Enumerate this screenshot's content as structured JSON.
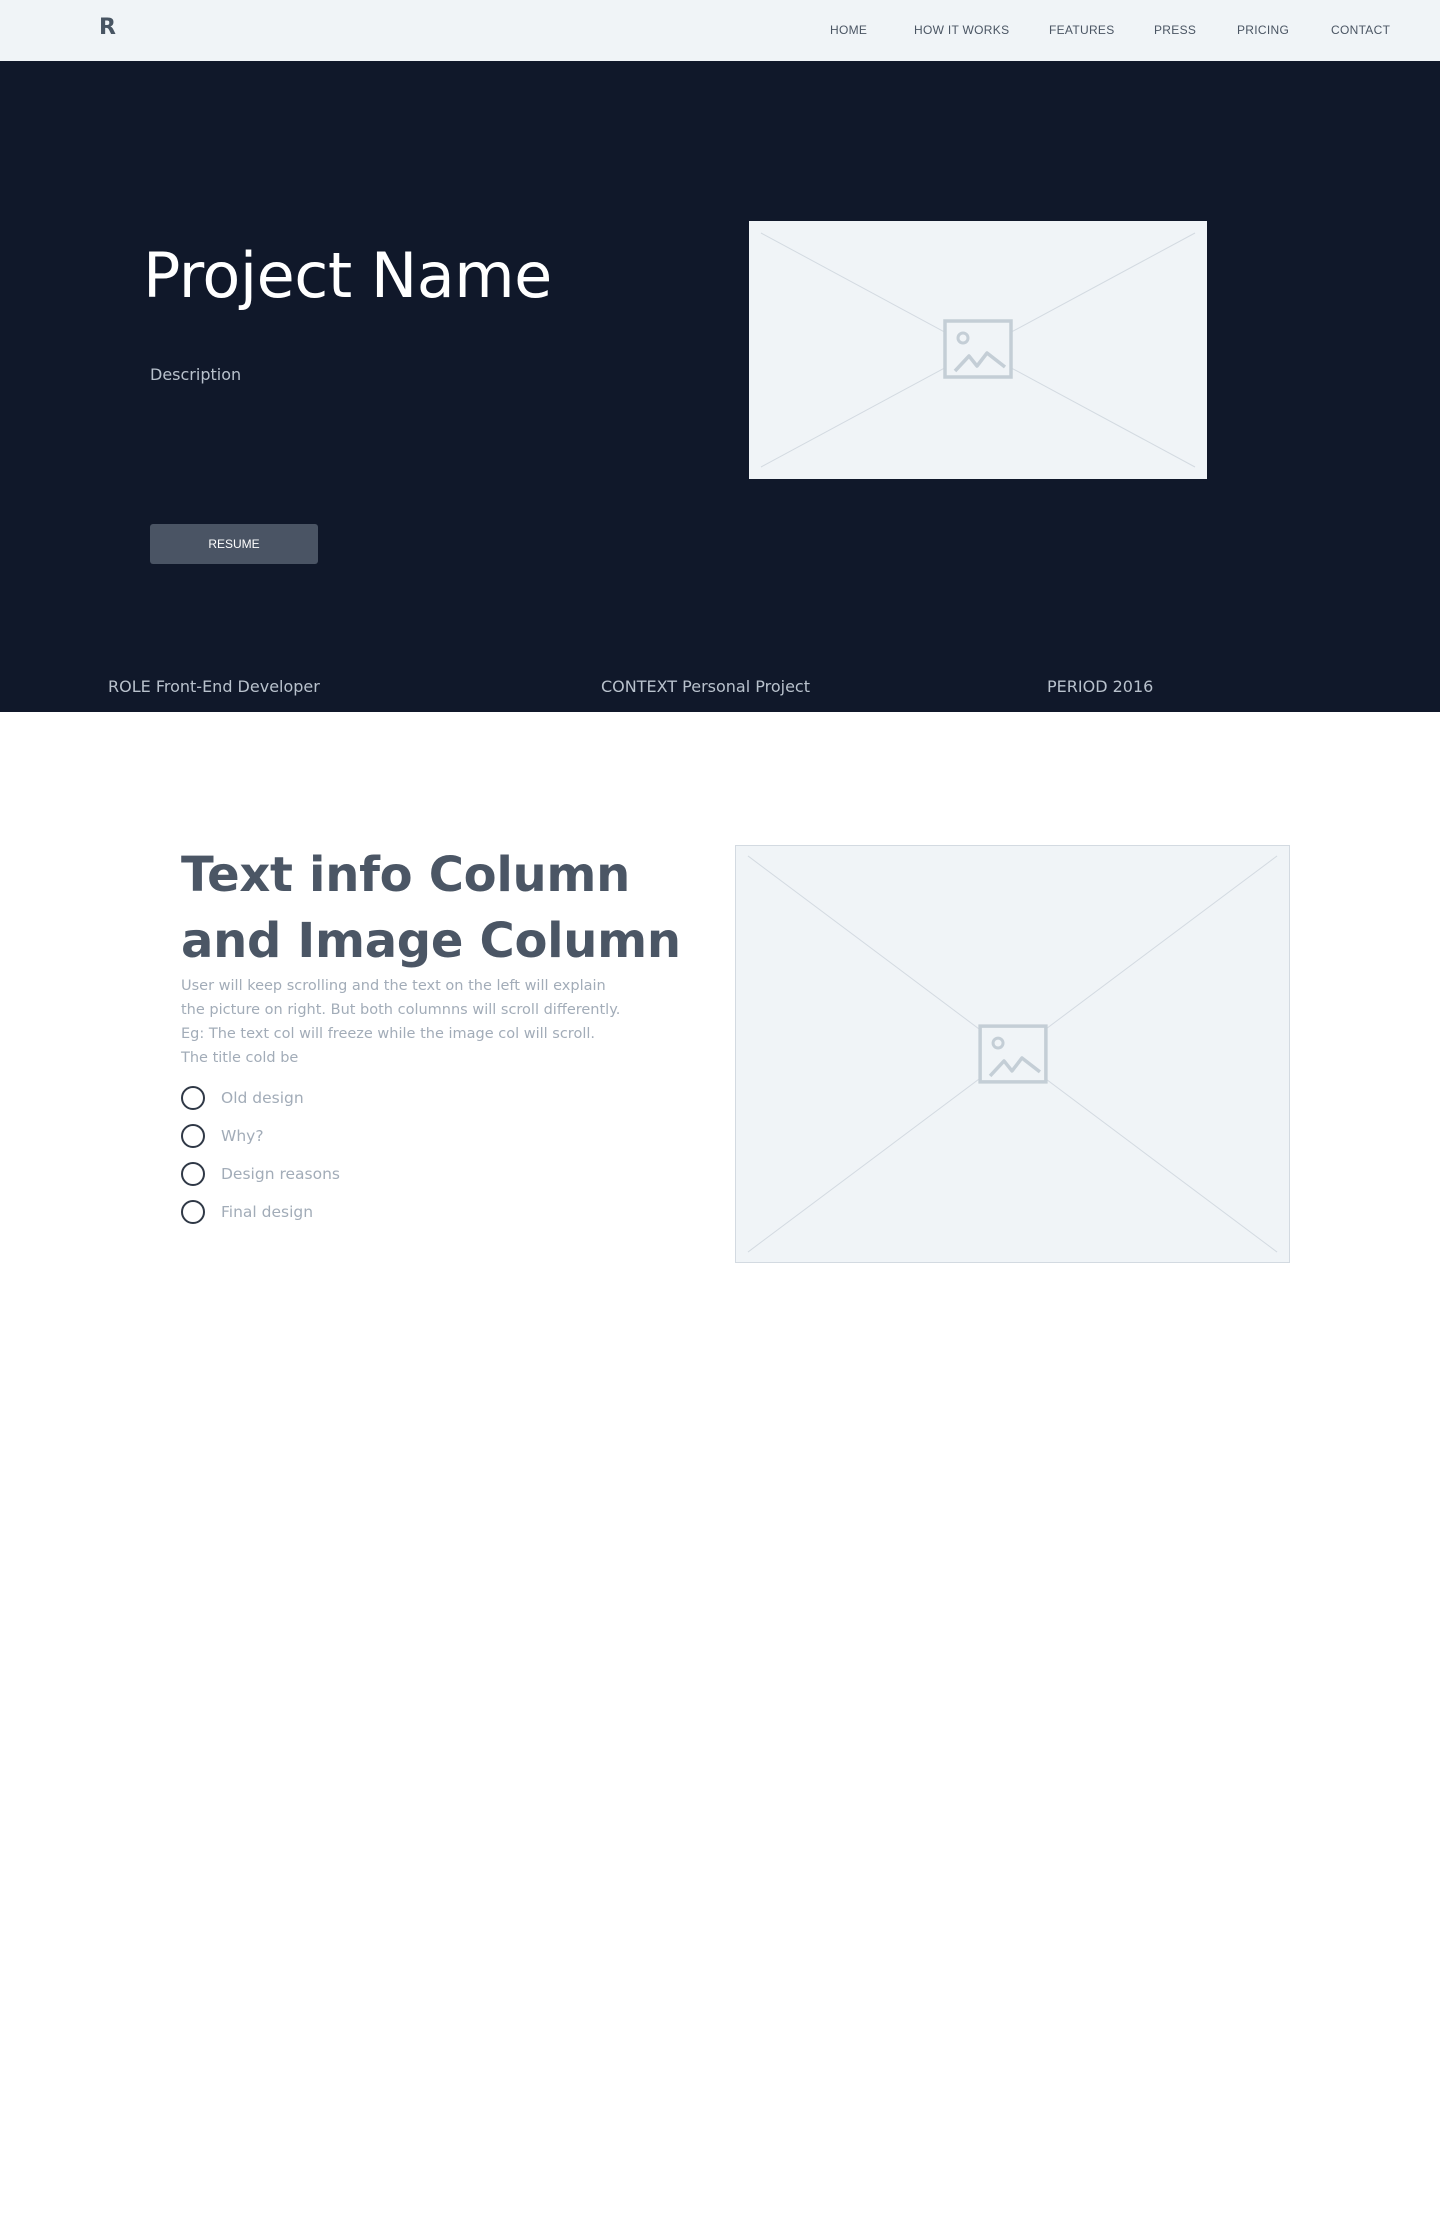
{
  "header": {
    "logo": "R",
    "nav": [
      "HOME",
      "HOW IT WORKS",
      "FEATURES",
      "PRESS",
      "PRICING",
      "CONTACT"
    ]
  },
  "hero": {
    "title": "Project Name",
    "description": "Description",
    "resume_label": "RESUME",
    "meta": {
      "role": "ROLE Front-End Developer",
      "context": "CONTEXT Personal Project",
      "period": "PERIOD 2016"
    }
  },
  "info": {
    "title": "Text info Column and Image Column",
    "body": "User will keep scrolling and the text on the left will explain the picture on right. But both columnns will scroll differently. Eg: The text col will freeze while the image col will scroll. The title cold be",
    "list": [
      "Old design",
      "Why?",
      "Design reasons",
      "Final design"
    ]
  },
  "colors": {
    "hero_bg": "#10182a",
    "topbar_bg": "#f0f4f7",
    "placeholder_bg": "#f0f4f7",
    "button_bg": "#4a5464"
  }
}
